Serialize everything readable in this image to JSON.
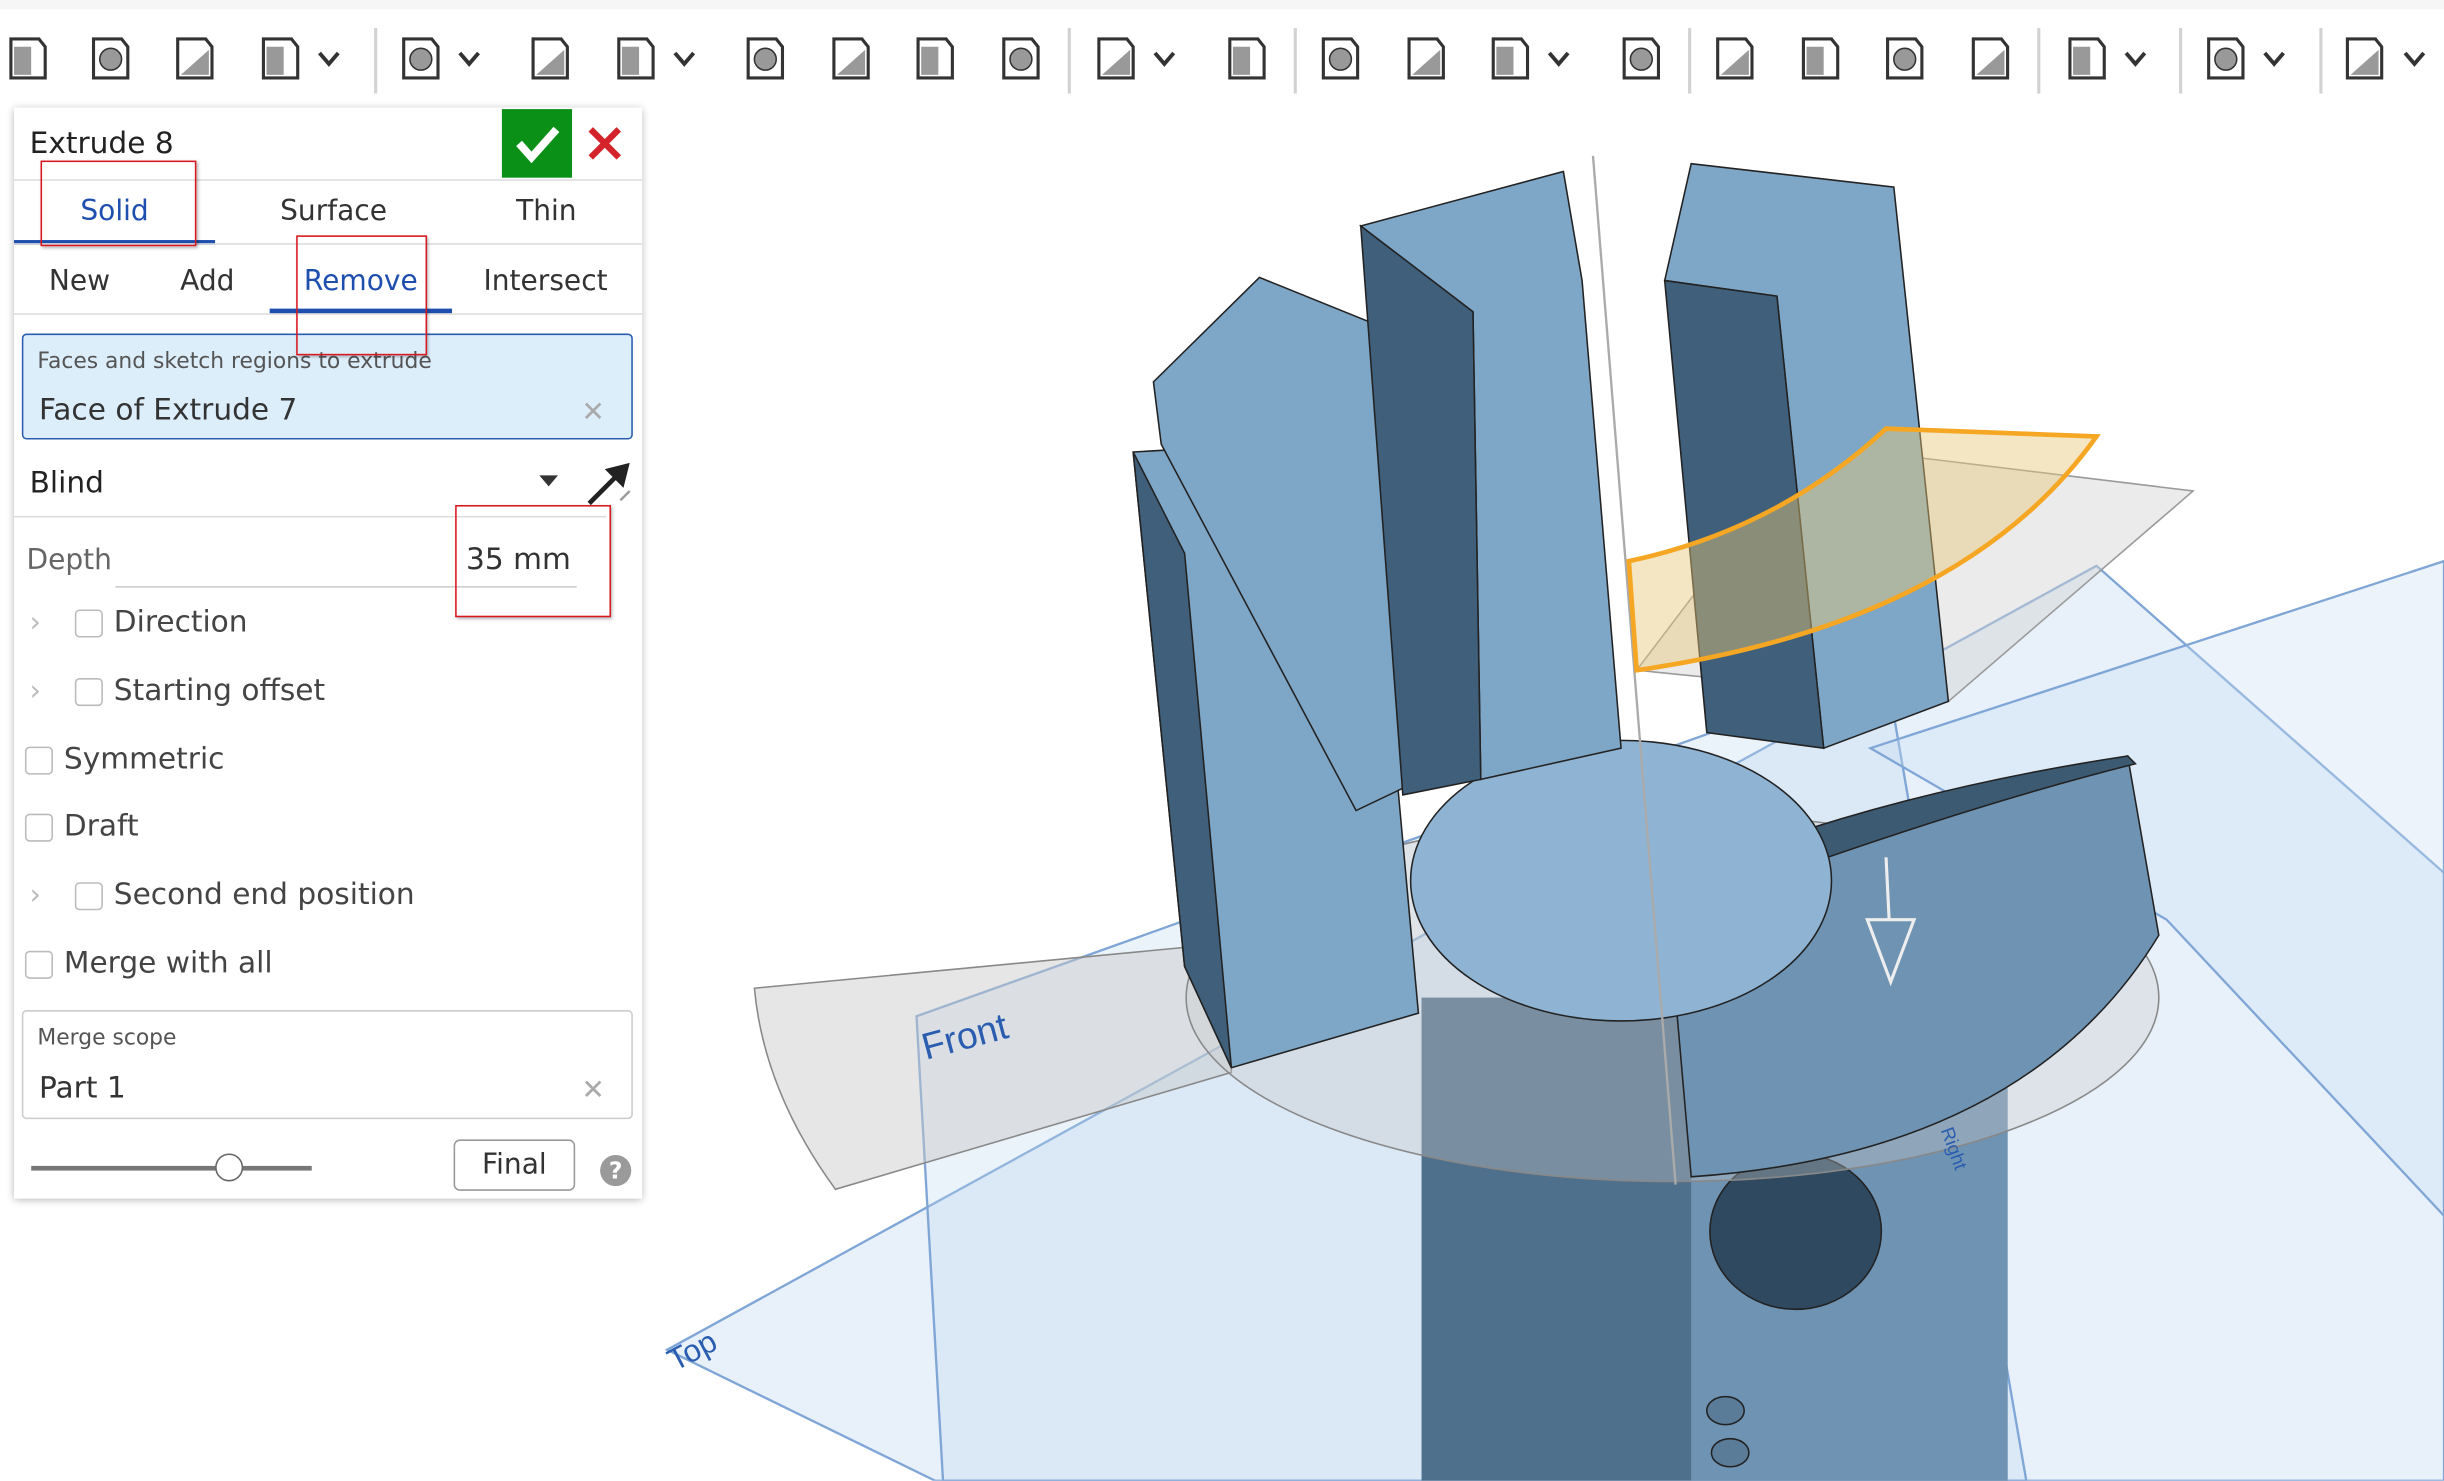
{
  "toolbar": {
    "icons": [
      "revolve-icon",
      "sweep-icon",
      "loft-icon",
      "thicken-icon",
      "fillet-icon",
      "chamfer-icon",
      "draft-icon",
      "rib-icon",
      "shell-icon",
      "hole-icon",
      "thread-icon",
      "pattern-icon",
      "mirror-icon",
      "boolean-icon",
      "split-icon",
      "transform-icon",
      "delete-part-icon",
      "modify-face-icon",
      "delete-face-icon",
      "move-face-icon",
      "replace-face-icon",
      "plane-icon",
      "sheet-metal-icon",
      "flange-icon"
    ]
  },
  "panel": {
    "title": "Extrude 8",
    "confirm_icon": "checkmark-icon",
    "cancel_icon": "close-icon",
    "body_tabs": [
      {
        "label": "Solid",
        "active": true
      },
      {
        "label": "Surface",
        "active": false
      },
      {
        "label": "Thin",
        "active": false
      }
    ],
    "op_tabs": [
      {
        "label": "New",
        "active": false
      },
      {
        "label": "Add",
        "active": false
      },
      {
        "label": "Remove",
        "active": true
      },
      {
        "label": "Intersect",
        "active": false
      }
    ],
    "selection": {
      "label": "Faces and sketch regions to extrude",
      "value": "Face of Extrude 7"
    },
    "end_type": "Blind",
    "depth": {
      "label": "Depth",
      "value": "35 mm"
    },
    "options": [
      {
        "label": "Direction",
        "expandable": true,
        "checked": false
      },
      {
        "label": "Starting offset",
        "expandable": true,
        "checked": false
      },
      {
        "label": "Symmetric",
        "expandable": false,
        "checked": false
      },
      {
        "label": "Draft",
        "expandable": false,
        "checked": false
      },
      {
        "label": "Second end position",
        "expandable": true,
        "checked": false
      },
      {
        "label": "Merge with all",
        "expandable": false,
        "checked": false
      }
    ],
    "merge_scope": {
      "label": "Merge scope",
      "value": "Part 1"
    },
    "slider_value": 0.7,
    "final_label": "Final",
    "help_label": "?"
  },
  "viewport": {
    "plane_labels": {
      "front": "Front",
      "top": "Top",
      "right": "Right"
    },
    "colors": {
      "part": "#7ea6c6",
      "selection": "#f5a623",
      "plane": "#7fa6d6"
    }
  }
}
